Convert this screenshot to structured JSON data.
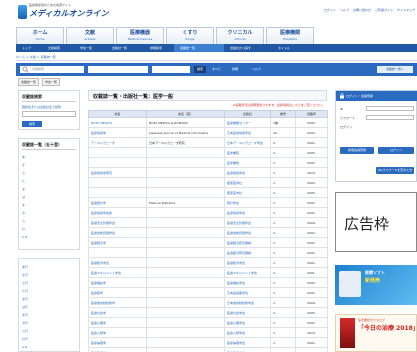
{
  "header": {
    "logo_tagline": "医療関係者のための情報サイト",
    "logo_text": "メディカルオンライン",
    "toplinks": [
      "ログイン",
      "ヘルプ",
      "お問い合わせ",
      "ご利用ガイド",
      "サイトマップ"
    ]
  },
  "nav": {
    "tabs": [
      {
        "label": "ホーム",
        "sub": "Home"
      },
      {
        "label": "文献",
        "sub": "Articles"
      },
      {
        "label": "医療機器",
        "sub": "Medical Devices"
      },
      {
        "label": "くすり",
        "sub": "Drugs"
      },
      {
        "label": "クリニカル",
        "sub": "Clinical"
      },
      {
        "label": "医療機関",
        "sub": "Hospitals"
      }
    ]
  },
  "subnav": {
    "items": [
      "トップ",
      "文献検索",
      "学会一覧",
      "出版社一覧",
      "詳細検索",
      "収載誌一覧",
      "出版社から探す",
      "タイトル"
    ]
  },
  "breadcrumb": "ホーム ＞ 文献 ＞ 収載誌一覧",
  "search": {
    "placeholder": "文献検索",
    "button": "検索",
    "opt1": "すべて",
    "opt2": "詳細",
    "opt3": "ヘルプ",
    "right_button": "収載誌一覧へ"
  },
  "subtabs": [
    "収載誌一覧",
    "学会一覧"
  ],
  "sidebar": {
    "box1_title": "収載誌検索",
    "box1_items": [
      "雑誌名または出版社名で検索",
      "検索"
    ],
    "box2_title": "収載誌一覧（五十音）",
    "box2_items": [
      "あ",
      "か",
      "さ",
      "た",
      "な",
      "は",
      "ま",
      "や",
      "ら",
      "わ",
      "A-Z"
    ],
    "box3_items": [
      "あ行",
      "か行",
      "さ行",
      "た行",
      "な行",
      "は行",
      "ま行",
      "や行",
      "ら行",
      "わ行",
      "A-Z"
    ]
  },
  "main": {
    "title": "収載誌一覧・出版社一覧：医学一般",
    "note": "※収載状況は随時更新されます。最新情報はこちらをご覧ください。",
    "columns": [
      "誌名",
      "誌名（英）",
      "出版社",
      "巻号",
      "収載年"
    ],
    "rows": [
      [
        "NOTA MEDICA",
        "NOTA MEDICA & ROMANA",
        "医療機器センター",
        "1巻-",
        "2005-"
      ],
      [
        "医療情報学",
        "Japanese Journal of Medical Informatics",
        "日本医療情報学会",
        "22-",
        "2002-"
      ],
      [
        "アーユルヴェーダ",
        "日本アーユルヴェーダ研究",
        "日本アーユルヴェーダ学会",
        "5-",
        "2001-"
      ],
      [
        "",
        "",
        "医学書院",
        "1-",
        "2005-"
      ],
      [
        "",
        "",
        "医学書院",
        "1-",
        "2001-"
      ],
      [
        "医療保健学研究",
        "",
        "医療保健学会",
        "1-",
        "2010-"
      ],
      [
        "",
        "",
        "臨床医学社",
        "1-",
        "2005-"
      ],
      [
        "",
        "",
        "臨床医学社",
        "1-",
        "2005-"
      ],
      [
        "医療統計学",
        "Medical Statistics",
        "統計学会",
        "1-",
        "2001-"
      ],
      [
        "医療情報学会誌",
        "",
        "医療情報学会",
        "1-",
        "2001-"
      ],
      [
        "医療安全管理学会",
        "",
        "医療安全管理学会",
        "1-",
        "2006-"
      ],
      [
        "医療技術評価学会",
        "",
        "医療技術評価学会",
        "1-",
        "2002-"
      ],
      [
        "医療経済学",
        "",
        "医療経済研究機構",
        "1-",
        "2001-"
      ],
      [
        "",
        "",
        "医療経済研究機構",
        "1-",
        "2001-"
      ],
      [
        "医療経済学会",
        "",
        "医療経済学会",
        "1-",
        "2001-"
      ],
      [
        "医療マネジメント学会",
        "",
        "医療マネジメント学会",
        "1-",
        "2001-"
      ],
      [
        "医療福祉学",
        "",
        "医療福祉学会",
        "1-",
        "2005-"
      ],
      [
        "医療薬学",
        "",
        "日本医療薬学会",
        "1-",
        "2001-"
      ],
      [
        "医療放射線技術学",
        "",
        "日本放射線技術学会",
        "1-",
        "2006-"
      ],
      [
        "医療社会学",
        "",
        "医療社会学会",
        "1-",
        "2005-"
      ],
      [
        "医療心理学",
        "",
        "医療心理学会",
        "1-",
        "2001-"
      ],
      [
        "医療人類学",
        "",
        "医療人類学会",
        "1-",
        "2010-"
      ],
      [
        "医療倫理学",
        "",
        "医療倫理学会",
        "1-",
        "2001-"
      ],
      [
        "医療政策学",
        "",
        "医療政策学会",
        "1-",
        "2001-"
      ],
      [
        "医療法学",
        "",
        "医療法学会",
        "1-",
        "2010-"
      ]
    ]
  },
  "right": {
    "login_title": "ログイン・会員登録",
    "login_rows": [
      "ID",
      "パスワード",
      "ログイン"
    ],
    "login_btn1": "新規会員登録",
    "login_btn2": "ログイン",
    "login_btn3": "ID/パスワードを忘れた方",
    "ad_text": "広告枠",
    "banner1_title": "医療ソフト",
    "banner1_sub": "新発売",
    "banner2_sub": "医学書総合カタログ",
    "banner2_title": "「今日の治療 2018」"
  }
}
